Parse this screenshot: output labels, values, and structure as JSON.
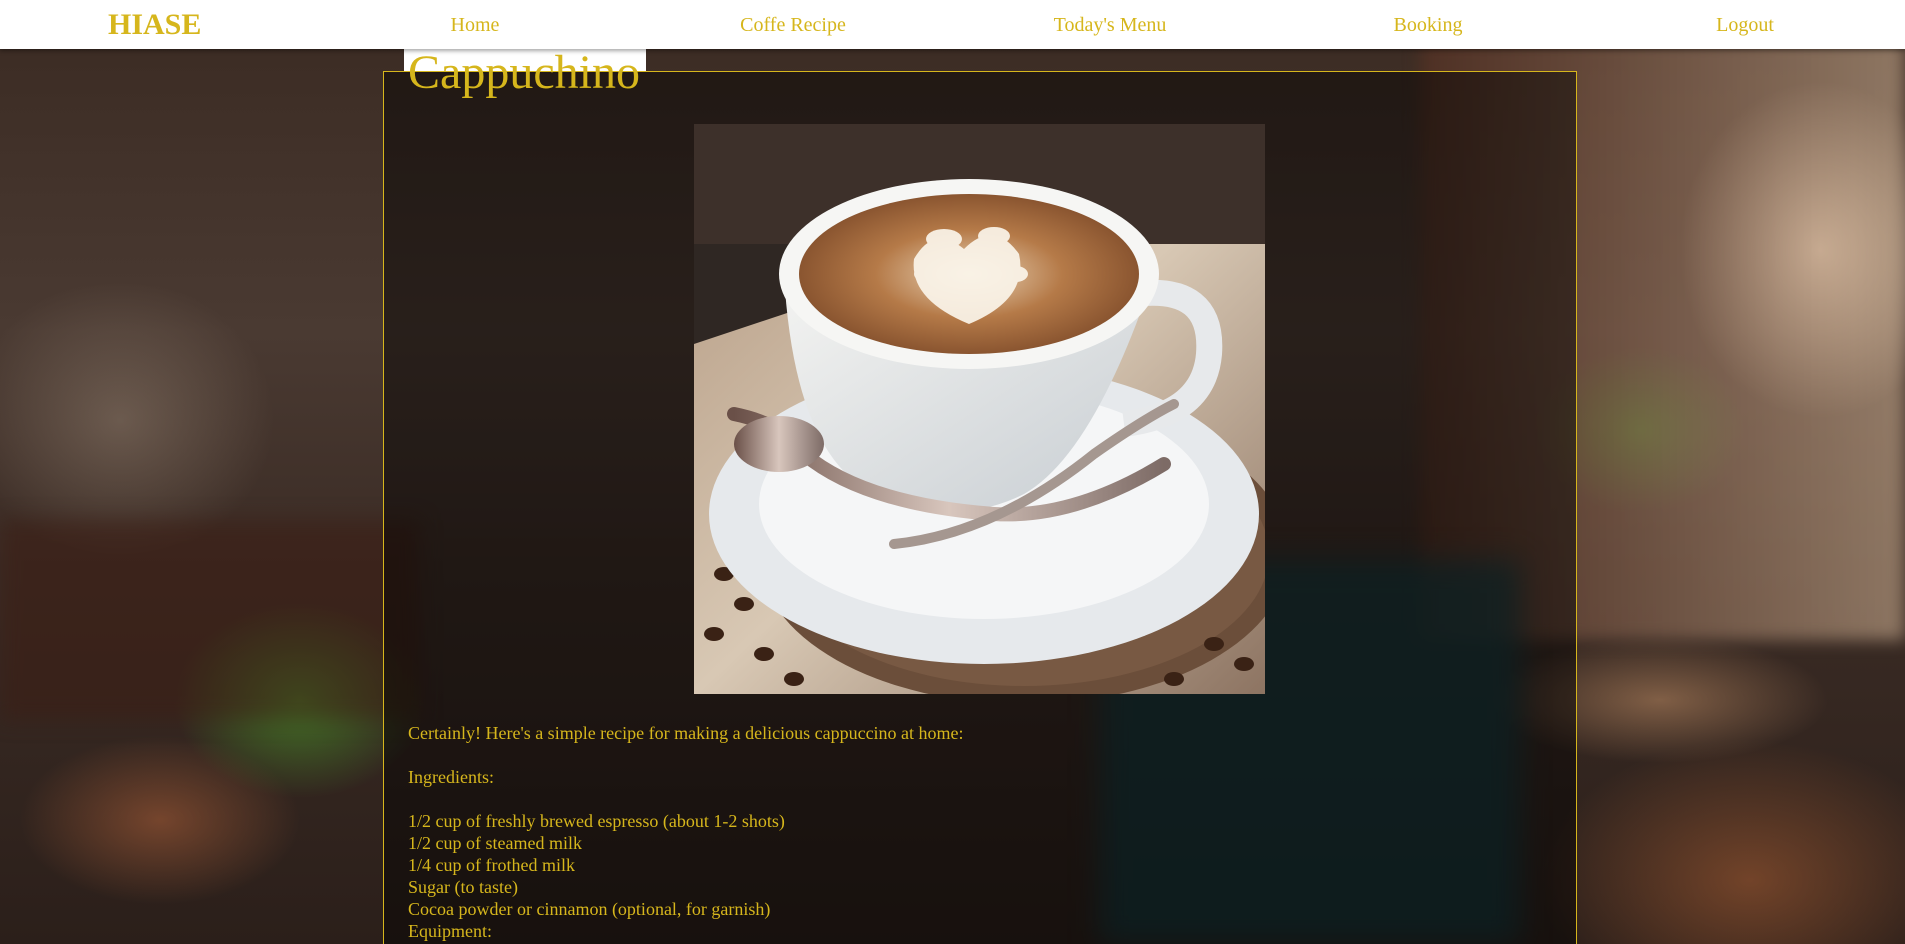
{
  "nav": {
    "brand": "HIASE",
    "links": [
      {
        "label": "Home"
      },
      {
        "label": "Coffe Recipe"
      },
      {
        "label": "Today's Menu"
      },
      {
        "label": "Booking"
      },
      {
        "label": "Logout"
      }
    ]
  },
  "recipe": {
    "title": "Cappuchino",
    "intro": "Certainly! Here's a simple recipe for making a delicious cappuccino at home:",
    "ingredients_heading": "Ingredients:",
    "ingredients": [
      "1/2 cup of freshly brewed espresso (about 1-2 shots)",
      "1/2 cup of steamed milk",
      "1/4 cup of frothed milk",
      "Sugar (to taste)",
      "Cocoa powder or cinnamon (optional, for garnish)"
    ],
    "equipment_heading": "Equipment:"
  },
  "colors": {
    "accent": "#d6b61c",
    "navbar_bg": "#ffffff"
  }
}
